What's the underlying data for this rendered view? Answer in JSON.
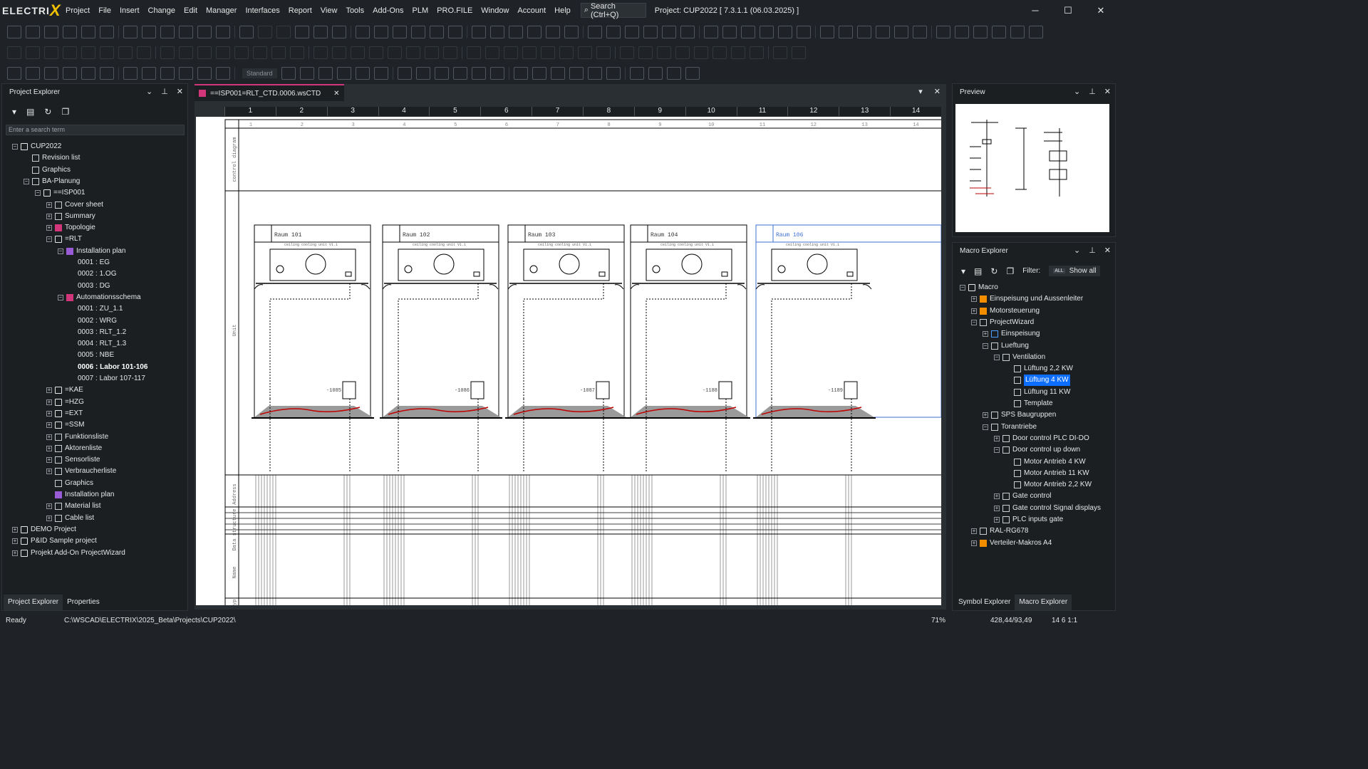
{
  "app": {
    "logo": "ELECTRIX",
    "project_title": "Project: CUP2022  [ 7.3.1.1 (06.03.2025) ]",
    "search_label": "Search (Ctrl+Q)"
  },
  "menu": [
    "Project",
    "File",
    "Insert",
    "Change",
    "Edit",
    "Manager",
    "Interfaces",
    "Report",
    "View",
    "Tools",
    "Add-Ons",
    "PLM",
    "PRO.FILE",
    "Window",
    "Account",
    "Help"
  ],
  "window_controls": [
    "─",
    "☐",
    "✕"
  ],
  "toolbar3": {
    "style_value": "Standard"
  },
  "project_explorer": {
    "title": "Project Explorer",
    "search_placeholder": "Enter a search term",
    "tree": [
      {
        "label": "CUP2022",
        "level": 0,
        "exp": "−",
        "icon": "folder"
      },
      {
        "label": "Revision list",
        "level": 1,
        "exp": "",
        "icon": "doc"
      },
      {
        "label": "Graphics",
        "level": 1,
        "exp": "",
        "icon": "doc"
      },
      {
        "label": "BA-Planung",
        "level": 1,
        "exp": "−",
        "icon": "doc"
      },
      {
        "label": "==ISP001",
        "level": 2,
        "exp": "−",
        "icon": "folder"
      },
      {
        "label": "Cover sheet",
        "level": 3,
        "exp": "+",
        "icon": "doc"
      },
      {
        "label": "Summary",
        "level": 3,
        "exp": "+",
        "icon": "doc"
      },
      {
        "label": "Topologie",
        "level": 3,
        "exp": "+",
        "icon": "pink"
      },
      {
        "label": "=RLT",
        "level": 3,
        "exp": "−",
        "icon": "folder"
      },
      {
        "label": "Installation plan",
        "level": 4,
        "exp": "−",
        "icon": "purple"
      },
      {
        "label": "0001 : EG",
        "level": 5,
        "exp": "",
        "icon": "none"
      },
      {
        "label": "0002 : 1.OG",
        "level": 5,
        "exp": "",
        "icon": "none"
      },
      {
        "label": "0003 : DG",
        "level": 5,
        "exp": "",
        "icon": "none"
      },
      {
        "label": "Automationsschema",
        "level": 4,
        "exp": "−",
        "icon": "pink"
      },
      {
        "label": "0001 : ZU_1.1",
        "level": 5,
        "exp": "",
        "icon": "none"
      },
      {
        "label": "0002 : WRG",
        "level": 5,
        "exp": "",
        "icon": "none"
      },
      {
        "label": "0003 : RLT_1.2",
        "level": 5,
        "exp": "",
        "icon": "none"
      },
      {
        "label": "0004 : RLT_1.3",
        "level": 5,
        "exp": "",
        "icon": "none"
      },
      {
        "label": "0005 : NBE",
        "level": 5,
        "exp": "",
        "icon": "none"
      },
      {
        "label": "0006 : Labor 101-106",
        "level": 5,
        "exp": "",
        "icon": "none",
        "bold": true
      },
      {
        "label": "0007 : Labor 107-117",
        "level": 5,
        "exp": "",
        "icon": "none"
      },
      {
        "label": "=KAE",
        "level": 3,
        "exp": "+",
        "icon": "folder"
      },
      {
        "label": "=HZG",
        "level": 3,
        "exp": "+",
        "icon": "folder"
      },
      {
        "label": "=EXT",
        "level": 3,
        "exp": "+",
        "icon": "folder"
      },
      {
        "label": "=SSM",
        "level": 3,
        "exp": "+",
        "icon": "folder"
      },
      {
        "label": "Funktionsliste",
        "level": 3,
        "exp": "+",
        "icon": "doc"
      },
      {
        "label": "Aktorenliste",
        "level": 3,
        "exp": "+",
        "icon": "doc"
      },
      {
        "label": "Sensorliste",
        "level": 3,
        "exp": "+",
        "icon": "doc"
      },
      {
        "label": "Verbraucherliste",
        "level": 3,
        "exp": "+",
        "icon": "doc"
      },
      {
        "label": "Graphics",
        "level": 3,
        "exp": "",
        "icon": "doc"
      },
      {
        "label": "Installation plan",
        "level": 3,
        "exp": "",
        "icon": "purple"
      },
      {
        "label": "Material list",
        "level": 3,
        "exp": "+",
        "icon": "doc"
      },
      {
        "label": "Cable list",
        "level": 3,
        "exp": "+",
        "icon": "doc"
      },
      {
        "label": "DEMO Project",
        "level": 0,
        "exp": "+",
        "icon": "folder"
      },
      {
        "label": "P&ID Sample project",
        "level": 0,
        "exp": "+",
        "icon": "folder"
      },
      {
        "label": "Projekt Add-On ProjectWizard",
        "level": 0,
        "exp": "+",
        "icon": "folder"
      }
    ],
    "bottom_tabs": [
      "Project Explorer",
      "Properties"
    ]
  },
  "document": {
    "tab_title": "==ISP001=RLT_CTD.0006.wsCTD",
    "ruler": [
      "1",
      "2",
      "3",
      "4",
      "5",
      "6",
      "7",
      "8",
      "9",
      "10",
      "11",
      "12",
      "13",
      "14"
    ],
    "rooms": [
      "Raum 101",
      "Raum 102",
      "Raum 103",
      "Raum 104",
      "Raum 106"
    ],
    "unit_caption": "ceiling cooling unit V1.1",
    "left_labels": [
      "control diagram",
      "Unit",
      "Address",
      "Data structure",
      "Name",
      "Typ"
    ],
    "function_ids": [
      "-1085",
      "-1086",
      "-1087",
      "-1188",
      "-1189"
    ]
  },
  "preview": {
    "title": "Preview"
  },
  "macro_explorer": {
    "title": "Macro Explorer",
    "filter_label": "Filter:",
    "filter_value": "Show all",
    "filter_badge": "ALL",
    "tree": [
      {
        "label": "Macro",
        "level": 0,
        "exp": "−",
        "icon": "folder"
      },
      {
        "label": "Einspeisung und Aussenleiter",
        "level": 1,
        "exp": "+",
        "icon": "orange"
      },
      {
        "label": "Motorsteuerung",
        "level": 1,
        "exp": "+",
        "icon": "orange"
      },
      {
        "label": "ProjectWizard",
        "level": 1,
        "exp": "−",
        "icon": "doc"
      },
      {
        "label": "Einspeisung",
        "level": 2,
        "exp": "+",
        "icon": "blue"
      },
      {
        "label": "Lueftung",
        "level": 2,
        "exp": "−",
        "icon": "doc"
      },
      {
        "label": "Ventilation",
        "level": 3,
        "exp": "−",
        "icon": "doc"
      },
      {
        "label": "Lüftung 2,2 KW",
        "level": 4,
        "exp": "",
        "icon": "doc"
      },
      {
        "label": "Lüftung 4 KW",
        "level": 4,
        "exp": "",
        "icon": "doc",
        "sel": true
      },
      {
        "label": "Lüftung 11 KW",
        "level": 4,
        "exp": "",
        "icon": "doc"
      },
      {
        "label": "Template",
        "level": 4,
        "exp": "",
        "icon": "doc"
      },
      {
        "label": "SPS Baugruppen",
        "level": 2,
        "exp": "+",
        "icon": "doc"
      },
      {
        "label": "Torantriebe",
        "level": 2,
        "exp": "−",
        "icon": "doc"
      },
      {
        "label": "Door control PLC DI-DO",
        "level": 3,
        "exp": "+",
        "icon": "doc"
      },
      {
        "label": "Door control up down",
        "level": 3,
        "exp": "−",
        "icon": "doc"
      },
      {
        "label": "Motor Antrieb 4 KW",
        "level": 4,
        "exp": "",
        "icon": "doc"
      },
      {
        "label": "Motor Antrieb 11 KW",
        "level": 4,
        "exp": "",
        "icon": "doc"
      },
      {
        "label": "Motor Antrieb 2,2 KW",
        "level": 4,
        "exp": "",
        "icon": "doc"
      },
      {
        "label": "Gate control",
        "level": 3,
        "exp": "+",
        "icon": "doc"
      },
      {
        "label": "Gate control Signal displays",
        "level": 3,
        "exp": "+",
        "icon": "doc"
      },
      {
        "label": "PLC inputs gate",
        "level": 3,
        "exp": "+",
        "icon": "doc"
      },
      {
        "label": "RAL-RG678",
        "level": 1,
        "exp": "+",
        "icon": "doc"
      },
      {
        "label": "Verteiler-Makros A4",
        "level": 1,
        "exp": "+",
        "icon": "orange"
      }
    ],
    "bottom_tabs": [
      "Symbol Explorer",
      "Macro Explorer"
    ]
  },
  "status": {
    "ready": "Ready",
    "path": "C:\\WSCAD\\ELECTRIX\\2025_Beta\\Projects\\CUP2022\\",
    "zoom": "71%",
    "coords": "428,44/93,49",
    "grid": "14  6  1:1"
  }
}
